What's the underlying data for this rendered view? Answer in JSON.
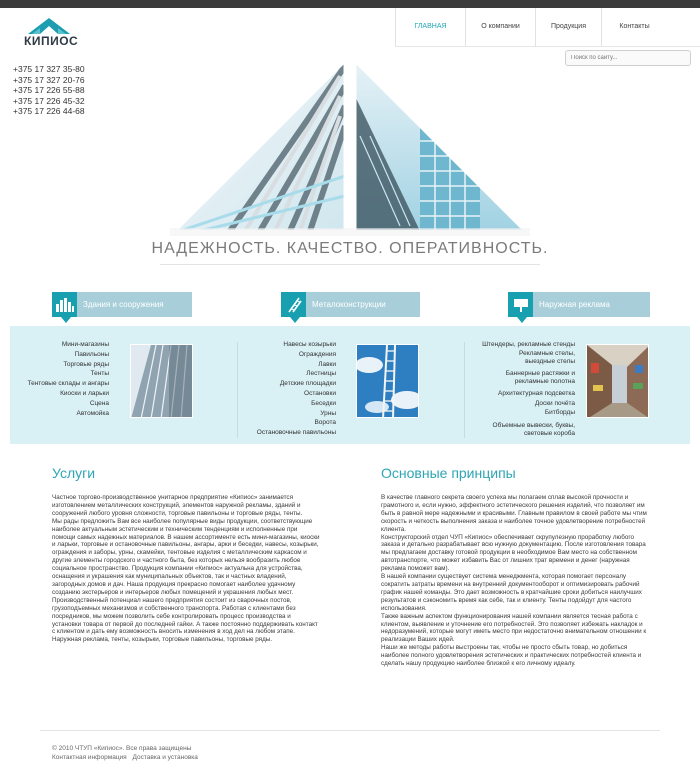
{
  "brand": {
    "name": "КИПИОС",
    "tagline": "",
    "accent": "#21a9b4",
    "logo_colors": [
      "#1c9db0",
      "#5bc2cd"
    ]
  },
  "nav": {
    "items": [
      {
        "label": "ГЛАВНАЯ",
        "active": true
      },
      {
        "label": "О компании",
        "active": false
      },
      {
        "label": "Продукция",
        "active": false
      },
      {
        "label": "Контакты",
        "active": false
      }
    ]
  },
  "search": {
    "placeholder": "Поиск по сайту..."
  },
  "phones": [
    "+375 17 327 35-80",
    "+375 17 327 20-76",
    "+375 17 226 55-88",
    "+375 17 226 45-32",
    "+375 17 226 44-68"
  ],
  "slogan": "НАДЕЖНОСТЬ. КАЧЕСТВО. ОПЕРАТИВНОСТЬ.",
  "categories": [
    {
      "title": "Здания и сооружения",
      "icon": "buildings-icon",
      "items": [
        "Мини-магазины",
        "Павильоны",
        "Торговые ряды",
        "Тенты",
        "Тентовые склады и ангары",
        "Киоски и ларьки",
        "Сцена",
        "Автомойка"
      ]
    },
    {
      "title": "Металоконструкции",
      "icon": "ladder-icon",
      "items": [
        "Навесы козырьки",
        "Ограждения",
        "Лавки",
        "Лестницы",
        "Детские площадки",
        "Остановки",
        "Беседки",
        "Урны",
        "Ворота",
        "Остановочные павильоны"
      ]
    },
    {
      "title": "Наружная реклама",
      "icon": "billboard-icon",
      "items": [
        "Штендеры, рекламные стенды",
        "Рекламные стелы, выездные стелы",
        "Баннерные растяжки и рекламные полотна",
        "Архитектурная подсветка",
        "Доски почёта",
        "Битборды",
        "Объемные вывески, буквы, световые короба"
      ]
    }
  ],
  "services": {
    "title": "Услуги",
    "paragraphs": [
      "Частное торгово-производственное унитарное предприятие «Кипиос» занимается изготовлением металлических конструкций, элементов наружной рекламы, зданий и сооружений любого уровня сложности, торговые павильоны и торговые ряды, тенты.",
      "Мы рады предложить Вам все наиболее популярные виды продукции, соответствующие наиболее актуальным эстетическим и техническим тенденциям и исполненные при помощи самых надежных материалов. В нашем ассортименте есть мини-магазины, киоски и ларьки, торговые и остановочные павильоны, ангары, арки и беседки, навесы, козырьки, ограждения и заборы, урны, скамейки, тентовые изделия с металлическим каркасом и другие элементы городского и частного быта, без которых нельзя вообразить любое социальное пространство. Продукция компании «Кипиос» актуальна для устройства, оснащения и украшения как муниципальных объектов, так и частных владений, загородных домов и дач. Наша продукция прекрасно помогает наиболее удачному созданию экстерьеров и интерьеров любых помещений и украшения любых мест.",
      "Производственный потенциал нашего предприятия состоит из сварочных постов, грузоподъемных механизмов и собственного транспорта. Работая с клиентами без посредников, мы можем позволить себе контролировать процесс производства и установки товара от первой до последней гайки. А также постоянно поддерживать контакт с клиентом и дать ему возможность вносить изменения в ход дел на любом этапе. Наружная реклама, тенты, козырьки, торговые павильоны, торговые ряды."
    ]
  },
  "principles": {
    "title": "Основные принципы",
    "paragraphs": [
      "В качестве главного секрета своего успеха мы полагаем сплав высокой прочности и грамотного и, если нужно, эффектного эстетического решения изделий, что позволяет им быть в равной мере надежными и красивыми. Главным правилом в своей работе мы чтим скорость и четкость выполнения заказа и наиболее точное удовлетворение потребностей клиента.",
      "Конструкторский отдел ЧУП «Кипиос» обеспечивает скрупулезную проработку любого заказа и детально разрабатывает всю нужную документацию. После изготовления товара мы предлагаем доставку готовой продукции в необходимое Вам место на собственном автотранспорте, что может избавить Вас от лишних трат времени и денег (наружная реклама поможет вам).",
      "В нашей компании существует система менеджмента, которая помогает персоналу сократить затраты времени на внутренний документооборот и оптимизировать рабочий график нашей команды. Это дает возможность в кратчайшие сроки добиться наилучших результатов и сэкономить время как себе, так и клиенту. Тенты подойдут для частого использования.",
      "Также важным аспектом функционирования нашей компании является тесная работа с клиентом, выявление и уточнение его потребностей. Это позволяет избежать накладок и недоразумений, которые могут иметь место при недостаточно внимательном отношении к реализации Ваших идей.",
      "Наши же методы работы выстроены так, чтобы не просто сбыть товар, но добиться наиболее полного удовлетворения эстетических и практических потребностей клиента и сделать нашу продукцию наиболее близкой к его личному идеалу."
    ]
  },
  "footer": {
    "copyright": "© 2010 ЧТУП «Кипиос». Все права защищены",
    "links": [
      "Контактная информация",
      "Доставка и установка"
    ]
  }
}
